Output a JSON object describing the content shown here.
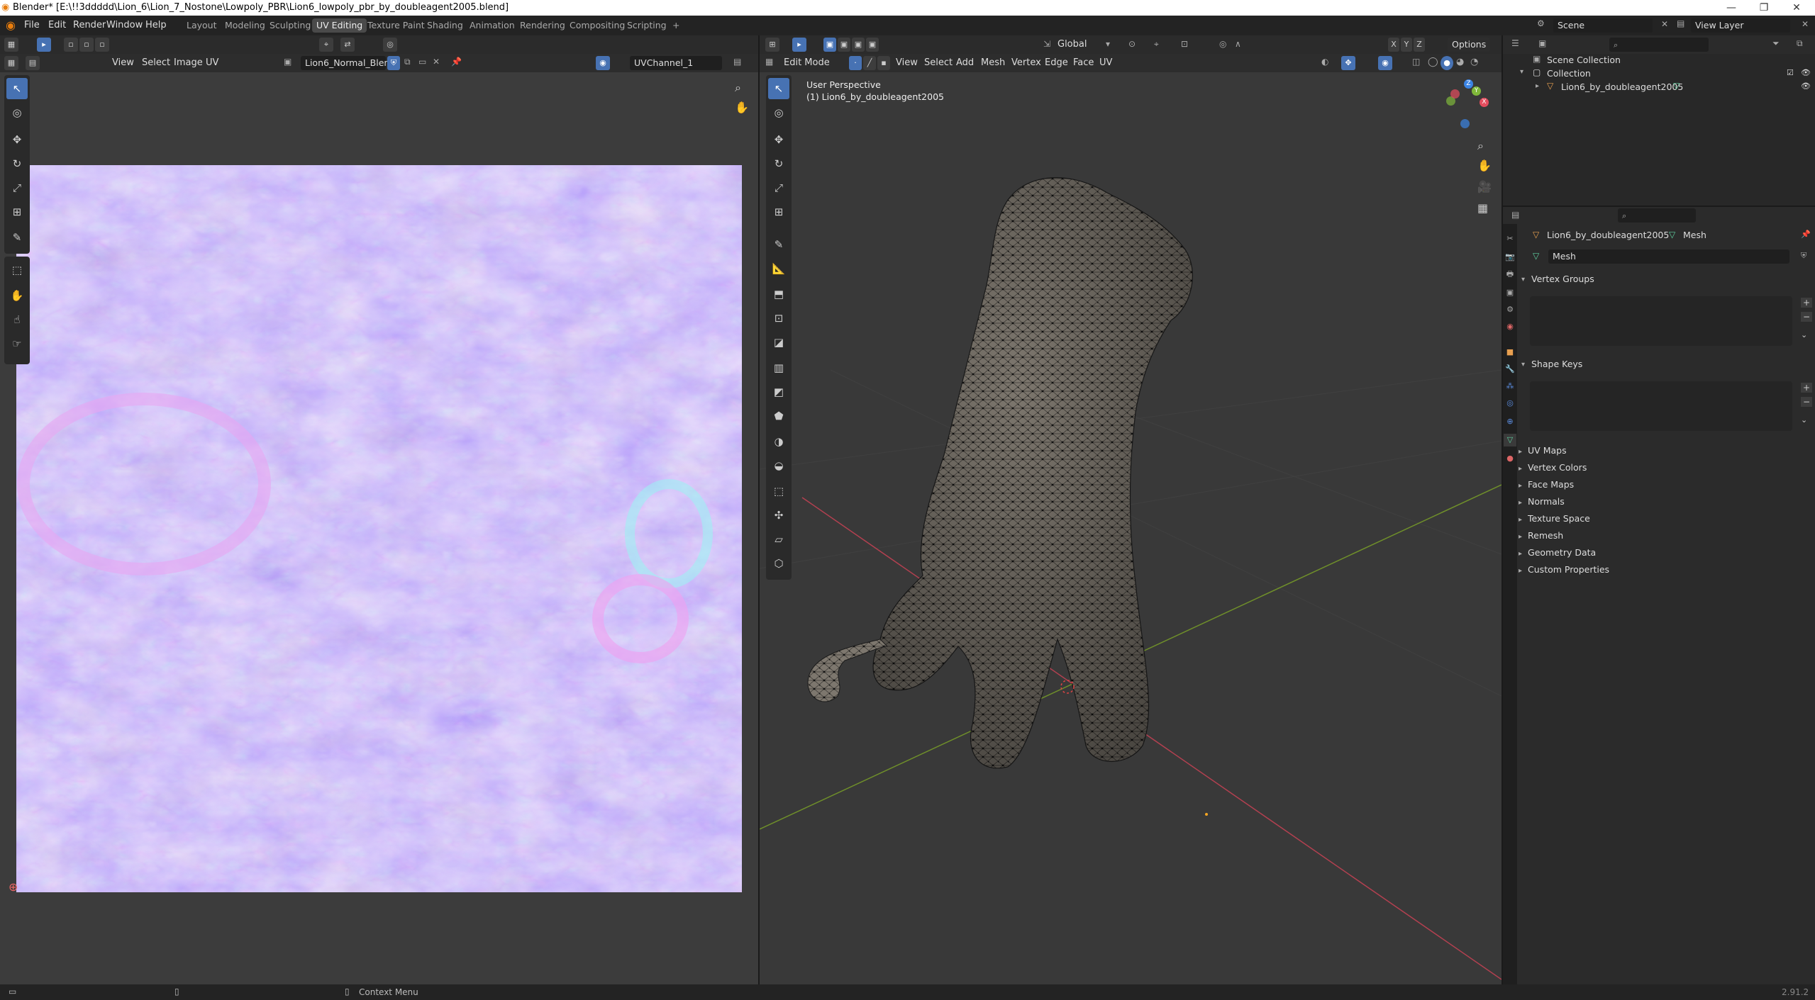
{
  "window": {
    "title": "Blender* [E:\\!!3ddddd\\Lion_6\\Lion_7_Nostone\\Lowpoly_PBR\\Lion6_lowpoly_pbr_by_doubleagent2005.blend]",
    "minimize": "—",
    "maximize": "❐",
    "close": "✕"
  },
  "menubar": {
    "items": [
      "File",
      "Edit",
      "Render",
      "Window",
      "Help"
    ]
  },
  "workspaces": [
    "Layout",
    "Modeling",
    "Sculpting",
    "UV Editing",
    "Texture Paint",
    "Shading",
    "Animation",
    "Rendering",
    "Compositing",
    "Scripting"
  ],
  "workspace_add": "+",
  "scene": {
    "scene_name": "Scene",
    "view_layer": "View Layer"
  },
  "uv_editor": {
    "menus": [
      "View",
      "Select",
      "Image",
      "UV"
    ],
    "image_name": "Lion6_Normal_Blen...",
    "uv_channel": "UVChannel_1"
  },
  "viewport": {
    "mode": "Edit Mode",
    "menus": [
      "View",
      "Select",
      "Add",
      "Mesh",
      "Vertex",
      "Edge",
      "Face",
      "UV"
    ],
    "orientation": "Global",
    "options": "Options",
    "overlay_line1": "User Perspective",
    "overlay_line2": "(1) Lion6_by_doubleagent2005",
    "axes": {
      "x": "X",
      "y": "Y",
      "z": "Z"
    },
    "axis_colors": {
      "x": "#e44d5e",
      "y": "#7fb83a",
      "z": "#3b84e4"
    }
  },
  "outliner": {
    "scene_collection": "Scene Collection",
    "collection": "Collection",
    "object": "Lion6_by_doubleagent2005"
  },
  "properties": {
    "object_name": "Lion6_by_doubleagent2005",
    "data_label": "Mesh",
    "mesh_field": "Mesh",
    "vertex_groups": "Vertex Groups",
    "shape_keys": "Shape Keys",
    "sections": [
      "UV Maps",
      "Vertex Colors",
      "Face Maps",
      "Normals",
      "Texture Space",
      "Remesh",
      "Geometry Data",
      "Custom Properties"
    ]
  },
  "statusbar": {
    "context": "Context Menu",
    "version": "2.91.2"
  }
}
